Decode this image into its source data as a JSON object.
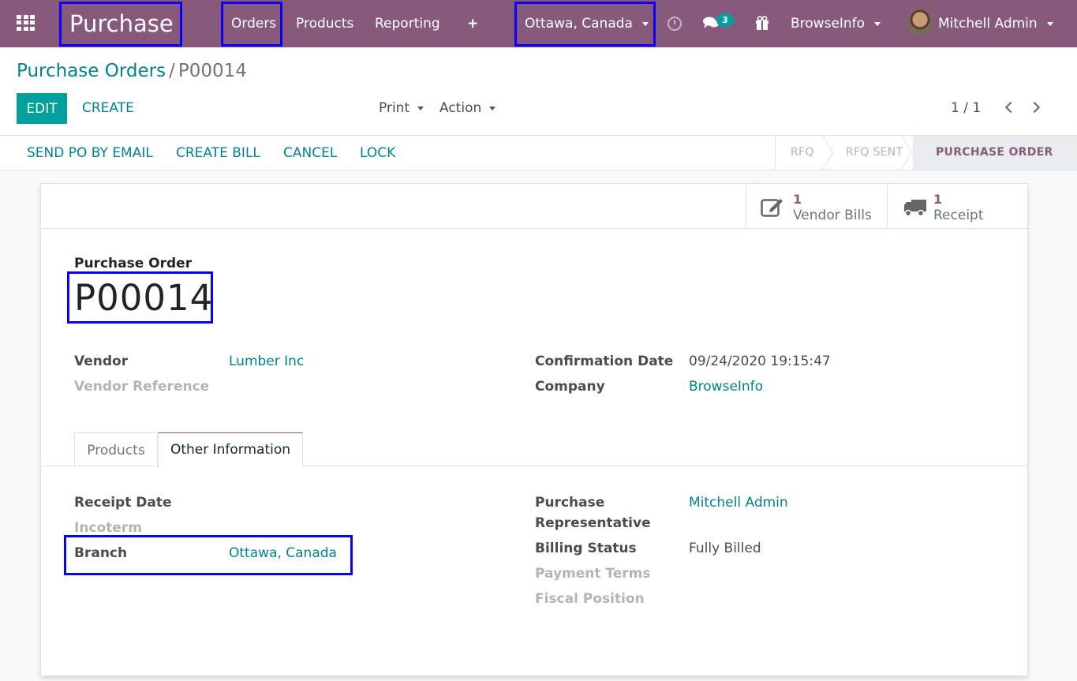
{
  "navbar": {
    "app_name": "Purchase",
    "menus": [
      "Orders",
      "Products",
      "Reporting"
    ],
    "branch": "Ottawa, Canada",
    "chat_count": "3",
    "company": "BrowseInfo",
    "user": "Mitchell Admin",
    "bg_color": "#875a7b"
  },
  "breadcrumb": {
    "parent": "Purchase Orders",
    "separator": "/",
    "current": "P00014"
  },
  "control": {
    "edit_label": "EDIT",
    "create_label": "CREATE",
    "print_label": "Print",
    "action_label": "Action",
    "pager": "1 / 1"
  },
  "statusbar": {
    "buttons": [
      "SEND PO BY EMAIL",
      "CREATE BILL",
      "CANCEL",
      "LOCK"
    ],
    "stages": [
      "RFQ",
      "RFQ SENT",
      "PURCHASE ORDER"
    ],
    "active_stage": "PURCHASE ORDER"
  },
  "smart_buttons": [
    {
      "count": "1",
      "label": "Vendor Bills",
      "icon": "pencil-square-icon"
    },
    {
      "count": "1",
      "label": "Receipt",
      "icon": "truck-icon"
    }
  ],
  "form": {
    "title_label": "Purchase Order",
    "name": "P00014",
    "vendor_label": "Vendor",
    "vendor": "Lumber Inc",
    "vendor_ref_label": "Vendor Reference",
    "confirmation_label": "Confirmation Date",
    "confirmation_date": "09/24/2020 19:15:47",
    "company_label": "Company",
    "company": "BrowseInfo"
  },
  "tabs": {
    "products": "Products",
    "other": "Other Information"
  },
  "other_info": {
    "receipt_date_label": "Receipt Date",
    "incoterm_label": "Incoterm",
    "branch_label": "Branch",
    "branch": "Ottawa, Canada",
    "rep_label_1": "Purchase",
    "rep_label_2": "Representative",
    "rep": "Mitchell Admin",
    "billing_label": "Billing Status",
    "billing": "Fully Billed",
    "payment_terms_label": "Payment Terms",
    "fiscal_position_label": "Fiscal Position"
  },
  "colors": {
    "accent": "#00a09d",
    "link": "#00838a",
    "brand": "#875a7b",
    "highlight_box": "#0a00ff"
  }
}
